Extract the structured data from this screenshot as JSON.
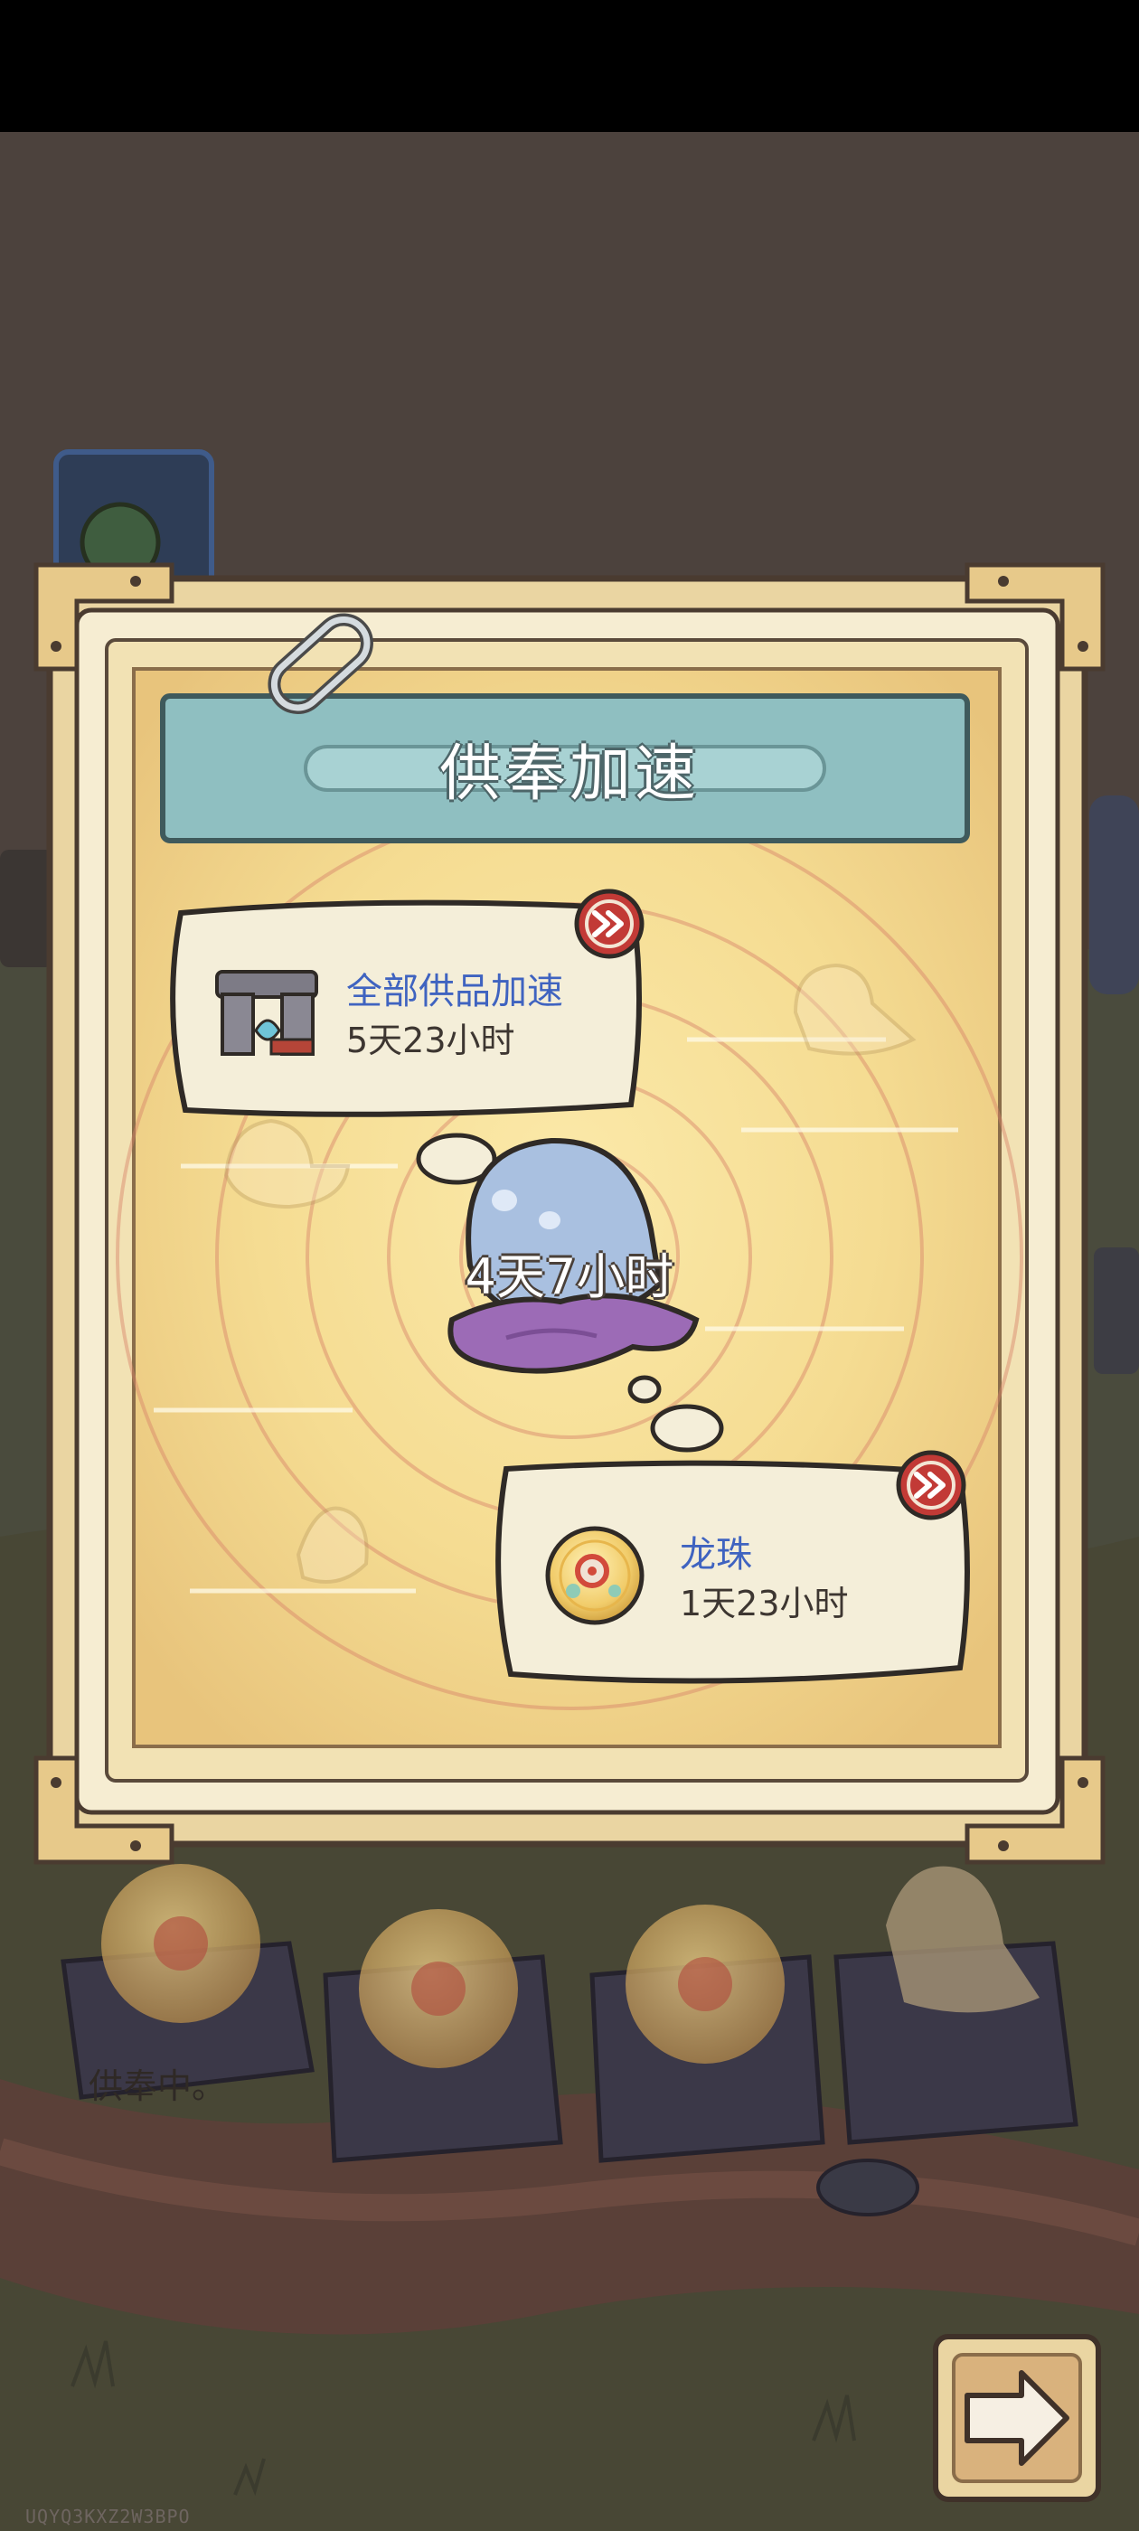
{
  "panel": {
    "title": "供奉加速"
  },
  "bubbles": [
    {
      "title": "全部供品加速",
      "time": "5天23小时"
    },
    {
      "title": "龙珠",
      "time": "1天23小时"
    }
  ],
  "center_time": "4天7小时",
  "status_text": "供奉中。",
  "watermark": "UQYQ3KXZ2W3BPO",
  "colors": {
    "title_banner": "#8fbfc1",
    "link_text": "#3f63c0",
    "speed_badge": "#c23a36",
    "parchment": "#f3d98e",
    "frame": "#ead5a2"
  },
  "icons": [
    "paperclip-icon",
    "stone-gate-icon",
    "dragon-pearl-icon",
    "fast-forward-icon",
    "ghost-icon",
    "arrow-right-icon"
  ]
}
